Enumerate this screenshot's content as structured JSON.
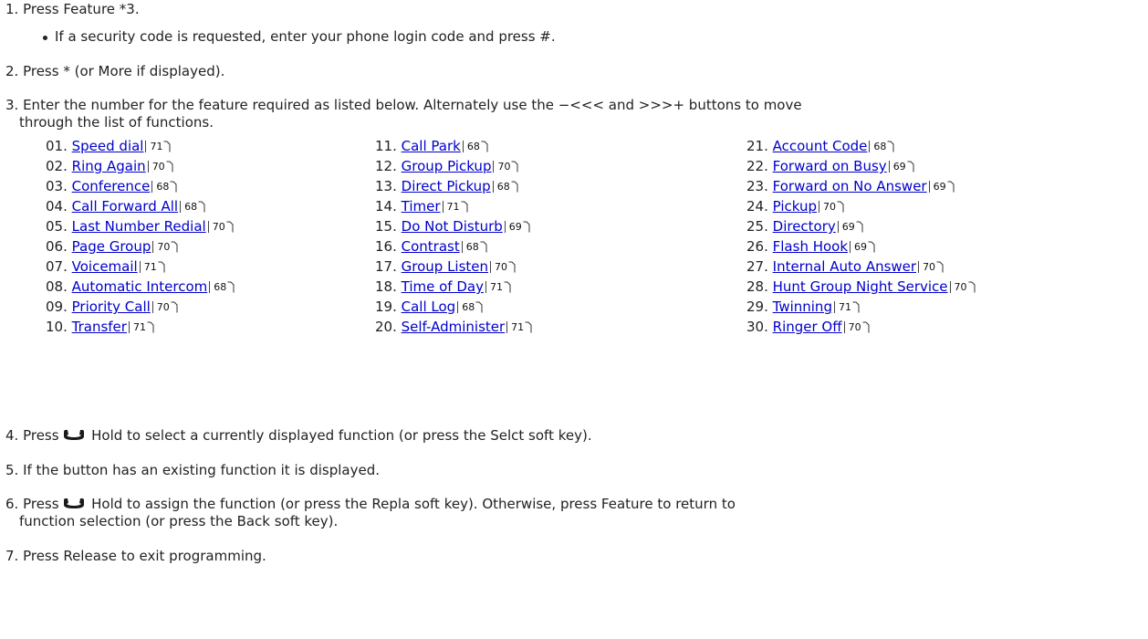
{
  "steps": {
    "s1": "1. Press Feature *3.",
    "s1_bullet": "If a security code is requested, enter your phone login code and press #.",
    "s2": "2. Press * (or More if displayed).",
    "s3a": "3. Enter the number for the feature required as listed below. Alternately use the −<<< and >>>+ buttons to move",
    "s3b": "through the list of functions.",
    "s4": "Hold to select a currently displayed function (or press the Selct soft key).",
    "s4_num": "4. Press",
    "s5": "5.  If the button has an existing function it is displayed.",
    "s6a": "Hold to assign the function (or press the Repla soft key). Otherwise, press Feature to return to",
    "s6_num": "6. Press",
    "s6b": "function selection (or press the Back soft key).",
    "s7": "7. Press Release to exit programming."
  },
  "functions": [
    {
      "num": "01.",
      "name": "Speed dial",
      "page": "71"
    },
    {
      "num": "02.",
      "name": "Ring Again",
      "page": "70"
    },
    {
      "num": "03.",
      "name": "Conference",
      "page": "68"
    },
    {
      "num": "04.",
      "name": "Call Forward All",
      "page": "68"
    },
    {
      "num": "05.",
      "name": "Last Number Redial",
      "page": "70"
    },
    {
      "num": "06.",
      "name": "Page Group",
      "page": "70"
    },
    {
      "num": "07.",
      "name": "Voicemail",
      "page": "71"
    },
    {
      "num": "08.",
      "name": "Automatic Intercom",
      "page": "68"
    },
    {
      "num": "09.",
      "name": "Priority Call",
      "page": "70"
    },
    {
      "num": "10.",
      "name": "Transfer",
      "page": "71"
    },
    {
      "num": "11.",
      "name": "Call Park",
      "page": "68"
    },
    {
      "num": "12.",
      "name": "Group Pickup",
      "page": "70"
    },
    {
      "num": "13.",
      "name": "Direct Pickup",
      "page": "68"
    },
    {
      "num": "14.",
      "name": "Timer",
      "page": "71"
    },
    {
      "num": "15.",
      "name": "Do Not Disturb",
      "page": "69"
    },
    {
      "num": "16.",
      "name": "Contrast",
      "page": "68"
    },
    {
      "num": "17.",
      "name": "Group Listen",
      "page": "70"
    },
    {
      "num": "18.",
      "name": "Time of Day",
      "page": "71"
    },
    {
      "num": "19.",
      "name": "Call Log",
      "page": "68"
    },
    {
      "num": "20.",
      "name": "Self-Administer",
      "page": "71"
    },
    {
      "num": "21.",
      "name": "Account Code",
      "page": "68"
    },
    {
      "num": "22.",
      "name": "Forward on Busy",
      "page": "69"
    },
    {
      "num": "23.",
      "name": "Forward on No Answer",
      "page": "69"
    },
    {
      "num": "24.",
      "name": "Pickup",
      "page": "70"
    },
    {
      "num": "25.",
      "name": "Directory",
      "page": "69"
    },
    {
      "num": "26.",
      "name": "Flash Hook",
      "page": "69"
    },
    {
      "num": "27.",
      "name": "Internal Auto Answer",
      "page": "70"
    },
    {
      "num": "28.",
      "name": "Hunt Group Night Service",
      "page": "70"
    },
    {
      "num": "29.",
      "name": "Twinning",
      "page": "71"
    },
    {
      "num": "30.",
      "name": "Ringer Off",
      "page": "70"
    }
  ],
  "colors": {
    "link": "#0000cc",
    "text": "#222222"
  },
  "icons": {
    "hold": "handset-icon",
    "page_ref": "page-reference-icon"
  }
}
